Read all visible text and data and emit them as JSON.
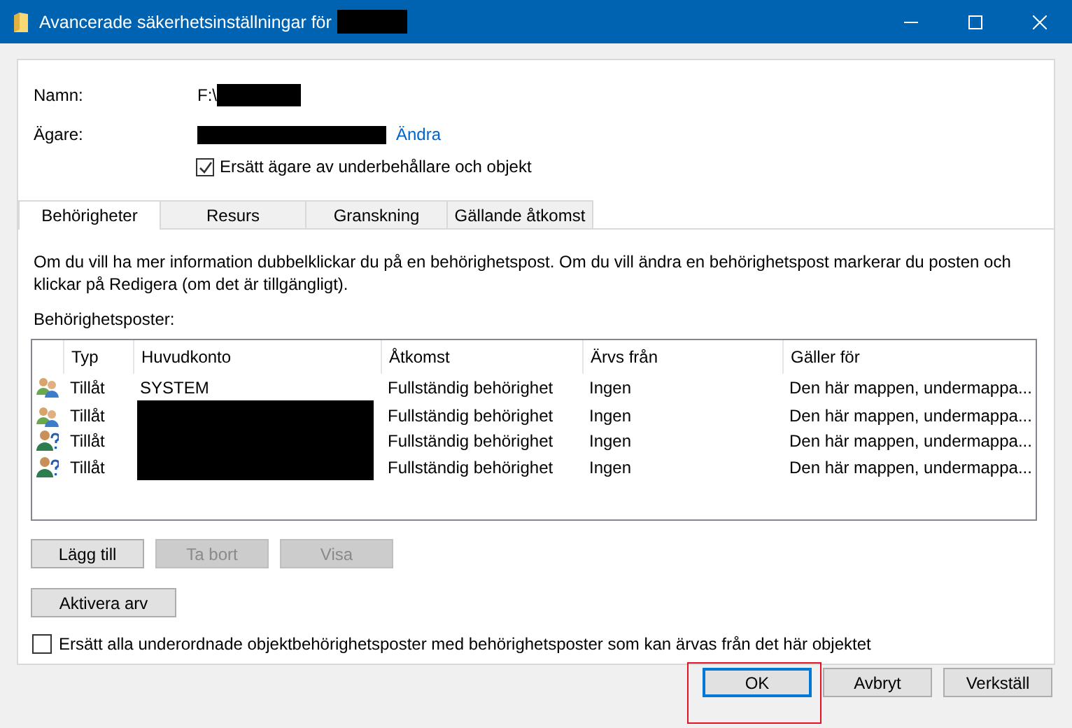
{
  "window": {
    "title": "Avancerade säkerhetsinställningar för",
    "title_redacted": true
  },
  "name": {
    "label": "Namn:",
    "value": "F:\\",
    "redacted": true
  },
  "owner": {
    "label": "Ägare:",
    "redacted": true,
    "link": "Ändra"
  },
  "replace_owner": {
    "label": "Ersätt ägare av underbehållare och objekt",
    "checked": true
  },
  "tabs": [
    {
      "label": "Behörigheter",
      "selected": true
    },
    {
      "label": "Resurs",
      "selected": false
    },
    {
      "label": "Granskning",
      "selected": false
    },
    {
      "label": "Gällande åtkomst",
      "selected": false
    }
  ],
  "info_text": "Om du vill ha mer information dubbelklickar du på en behörighetspost. Om du vill ändra en behörighetspost markerar du posten och klickar på Redigera (om det är tillgängligt).",
  "entries_label": "Behörighetsposter:",
  "table": {
    "columns": [
      "Typ",
      "Huvudkonto",
      "Åtkomst",
      "Ärvs från",
      "Gäller för"
    ],
    "rows": [
      {
        "kind": "group",
        "type": "Tillåt",
        "principal": "SYSTEM",
        "access": "Fullständig behörighet",
        "inherited_from": "Ingen",
        "applies_to": "Den här mappen, undermappa..."
      },
      {
        "kind": "group",
        "type": "Tillåt",
        "redacted": true,
        "access": "Fullständig behörighet",
        "inherited_from": "Ingen",
        "applies_to": "Den här mappen, undermappa..."
      },
      {
        "kind": "unknown",
        "type": "Tillåt",
        "redacted": true,
        "access": "Fullständig behörighet",
        "inherited_from": "Ingen",
        "applies_to": "Den här mappen, undermappa..."
      },
      {
        "kind": "unknown",
        "type": "Tillåt",
        "redacted": true,
        "access": "Fullständig behörighet",
        "inherited_from": "Ingen",
        "applies_to": "Den här mappen, undermappa..."
      }
    ]
  },
  "entry_buttons": [
    {
      "label": "Lägg till",
      "disabled": false
    },
    {
      "label": "Ta bort",
      "disabled": true
    },
    {
      "label": "Visa",
      "disabled": true
    }
  ],
  "inheritance_button": {
    "label": "Aktivera arv"
  },
  "replace_children": {
    "label": "Ersätt alla underordnade objektbehörighetsposter med behörighetsposter som kan ärvas från det här objektet",
    "checked": false
  },
  "dialog_buttons": [
    {
      "label": "OK",
      "default": true,
      "highlighted": true
    },
    {
      "label": "Avbryt",
      "default": false,
      "highlighted": false
    },
    {
      "label": "Verkställ",
      "default": false,
      "highlighted": false
    }
  ]
}
